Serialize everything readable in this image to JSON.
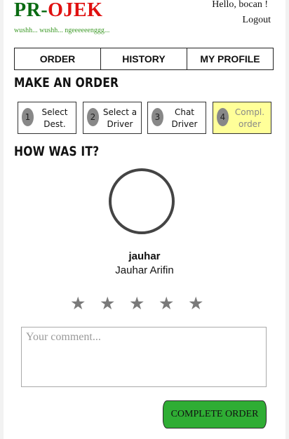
{
  "header": {
    "logo_part1": "PR",
    "logo_dash": "-",
    "logo_part2": "OJEK",
    "tagline": "wushh... wushh... ngeeeeeenggg...",
    "greeting": "Hello, bocan !",
    "logout_label": "Logout"
  },
  "tabs": [
    {
      "label": "ORDER"
    },
    {
      "label": "HISTORY"
    },
    {
      "label": "MY PROFILE"
    }
  ],
  "make_order": {
    "title": "MAKE AN ORDER",
    "steps": [
      {
        "number": "1",
        "label": "Select Dest.",
        "active": false
      },
      {
        "number": "2",
        "label": "Select a Driver",
        "active": false
      },
      {
        "number": "3",
        "label": "Chat Driver",
        "active": false
      },
      {
        "number": "4",
        "label": "Compl. order",
        "active": true
      }
    ]
  },
  "rating": {
    "title": "HOW WAS IT?",
    "avatar_alt": "jauhar",
    "username": "jauhar",
    "full_name": "Jauhar Arifin",
    "star_glyph": "★",
    "star_count": 5,
    "selected_stars": 0,
    "comment_placeholder": "Your comment...",
    "comment_value": "",
    "submit_label": "COMPLETE ORDER"
  },
  "colors": {
    "logo_green": "#0a6b12",
    "logo_red": "#e01010",
    "tagline_green": "#3f9b2a",
    "active_step": "#ffff99",
    "button_green": "#2fad34",
    "star_gray": "#7a7a7a"
  }
}
